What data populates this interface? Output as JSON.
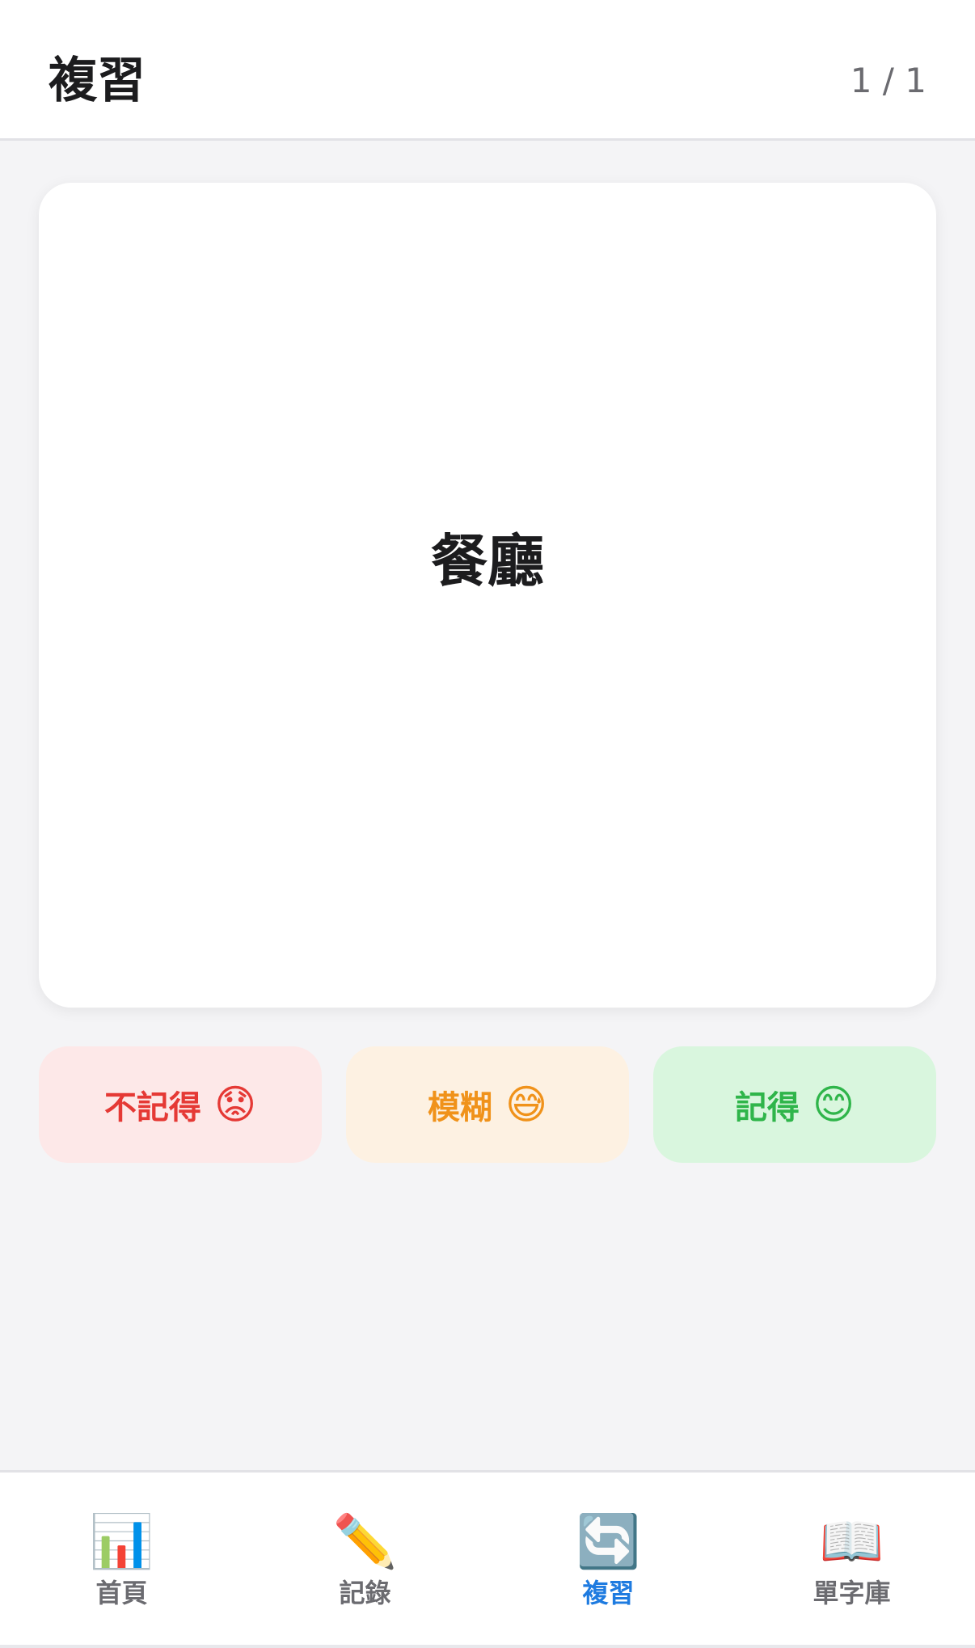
{
  "header": {
    "title": "複習",
    "progress": "1 / 1"
  },
  "card": {
    "word": "餐廳"
  },
  "answers": {
    "forget": {
      "label": "不記得",
      "emoji": "😟",
      "color": "#e53935",
      "bg": "#fde8e8"
    },
    "vague": {
      "label": "模糊",
      "emoji": "😅",
      "color": "#f0921a",
      "bg": "#fdf1e2"
    },
    "remember": {
      "label": "記得",
      "emoji": "😊",
      "color": "#2fb54a",
      "bg": "#d9f6de"
    }
  },
  "tabs": [
    {
      "label": "首頁",
      "icon": "📊",
      "icon_name": "bar-chart-icon",
      "active": false
    },
    {
      "label": "記錄",
      "icon": "✏️",
      "icon_name": "pencil-icon",
      "active": false
    },
    {
      "label": "複習",
      "icon": "🔄",
      "icon_name": "refresh-icon",
      "active": true
    },
    {
      "label": "單字庫",
      "icon": "📖",
      "icon_name": "open-book-icon",
      "active": false
    }
  ],
  "colors": {
    "accent": "#1e7be0",
    "background": "#f4f4f6"
  }
}
